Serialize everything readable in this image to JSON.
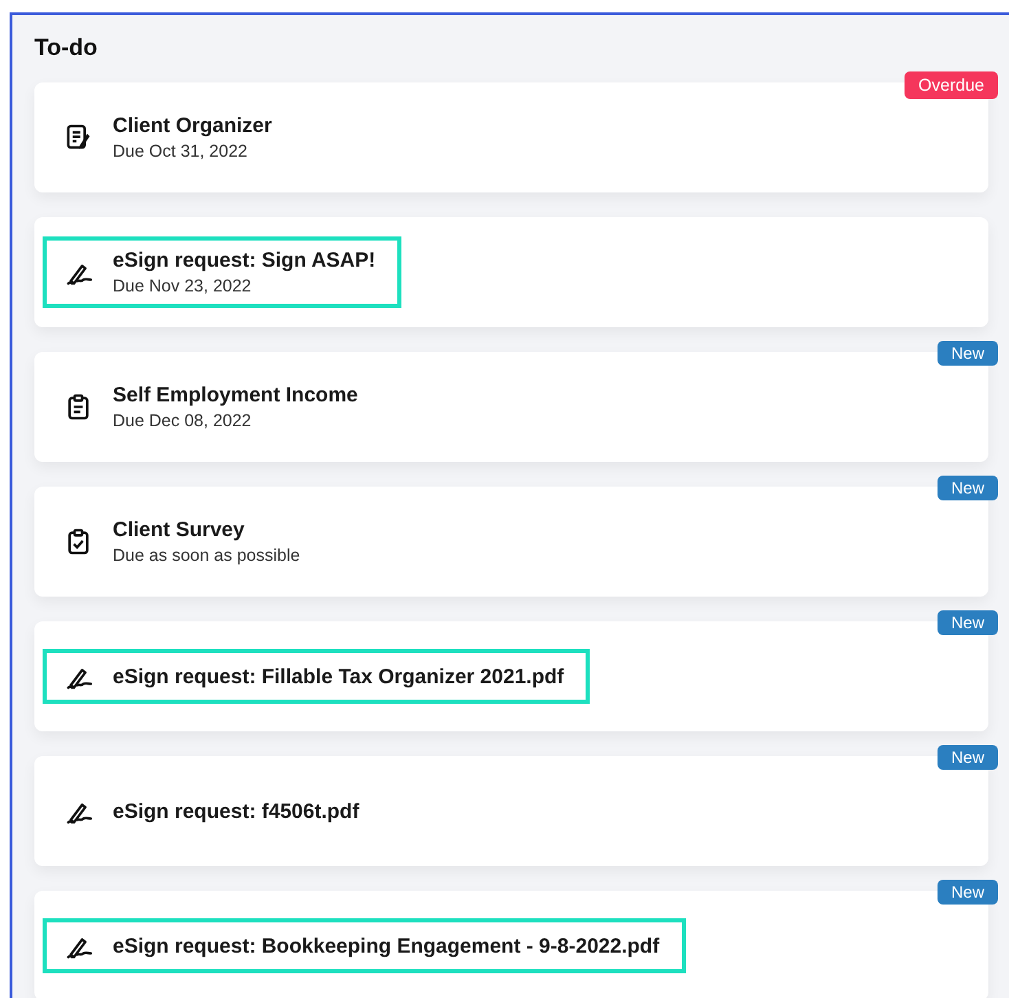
{
  "title": "To-do",
  "tasks": [
    {
      "kind": "organizer",
      "title": "Client Organizer",
      "due": "Due Oct 31, 2022",
      "badge": {
        "kind": "overdue",
        "label": "Overdue"
      },
      "highlighted": false
    },
    {
      "kind": "esign",
      "title": "eSign request: Sign ASAP!",
      "due": "Due Nov 23, 2022",
      "highlighted": true
    },
    {
      "kind": "clipboard",
      "title": "Self Employment Income",
      "due": "Due Dec 08, 2022",
      "badge": {
        "kind": "new",
        "label": "New"
      },
      "highlighted": false
    },
    {
      "kind": "survey",
      "title": "Client Survey",
      "due": "Due as soon as possible",
      "badge": {
        "kind": "new",
        "label": "New"
      },
      "highlighted": false
    },
    {
      "kind": "esign",
      "title": "eSign request: Fillable Tax Organizer 2021.pdf",
      "badge": {
        "kind": "new",
        "label": "New"
      },
      "highlighted": true
    },
    {
      "kind": "esign",
      "title": "eSign request: f4506t.pdf",
      "badge": {
        "kind": "new",
        "label": "New"
      },
      "highlighted": false
    },
    {
      "kind": "esign",
      "title": "eSign request: Bookkeeping Engagement - 9-8-2022.pdf",
      "badge": {
        "kind": "new",
        "label": "New"
      },
      "highlighted": true
    }
  ]
}
